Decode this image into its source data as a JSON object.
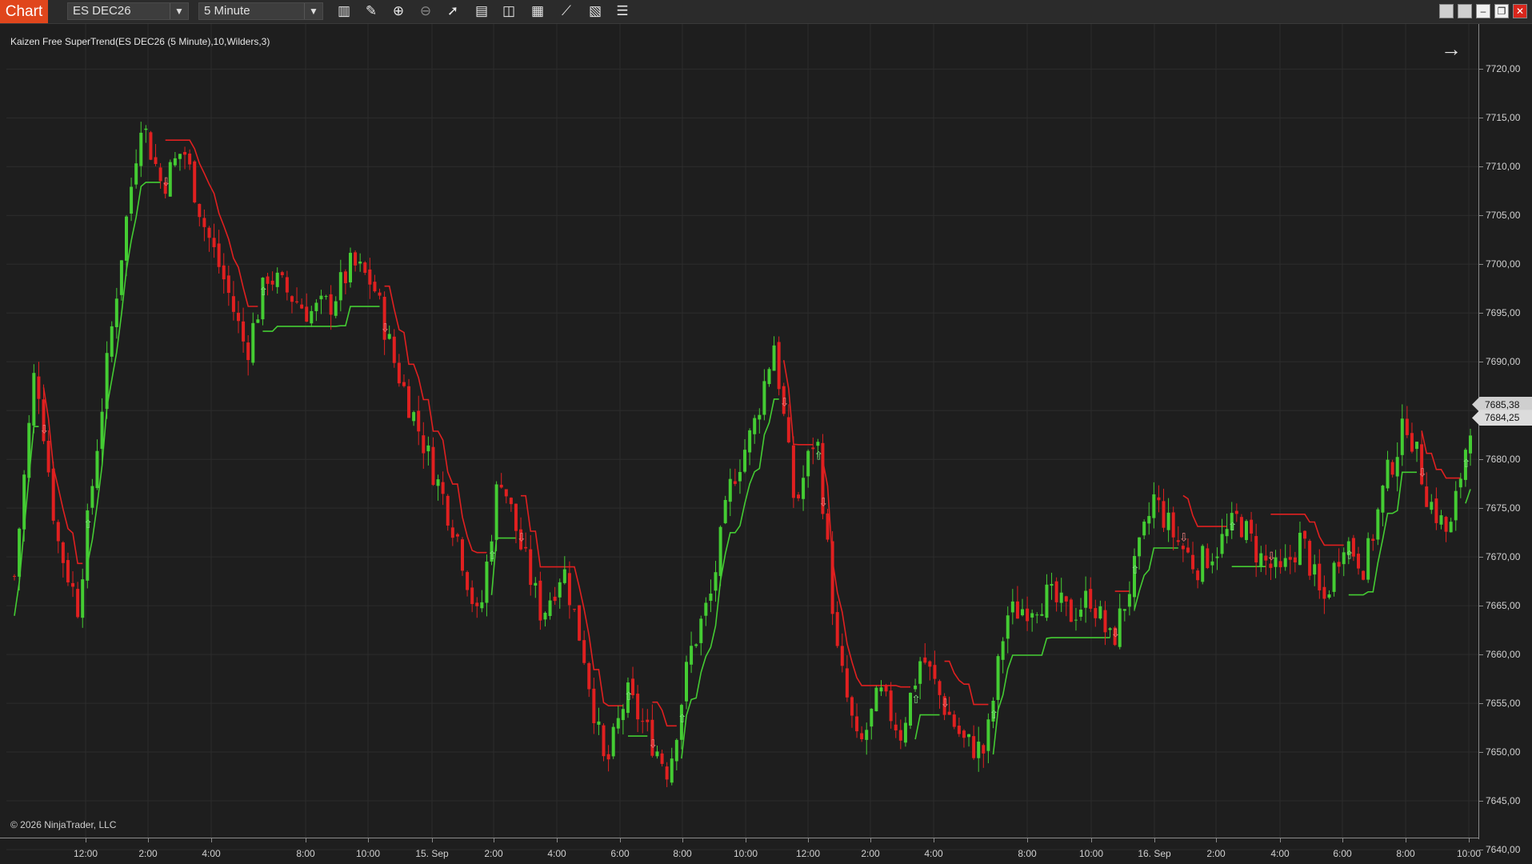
{
  "toolbar": {
    "tab_label": "Chart",
    "instrument": "ES DEC26",
    "interval": "5 Minute",
    "icons": [
      "bar-type-icon",
      "pencil-draw-icon",
      "zoom-in-icon",
      "zoom-out-icon",
      "pointer-icon",
      "data-box-icon",
      "properties-icon",
      "strategies-icon",
      "drawing-tools-icon",
      "chart-trader-icon",
      "indicators-icon"
    ]
  },
  "window_buttons": [
    "tile-icon",
    "float-icon",
    "minimize-icon",
    "maximize-icon",
    "close-icon"
  ],
  "indicator_label": "Kaizen Free SuperTrend(ES DEC26 (5 Minute),10,Wilders,3)",
  "copyright": "© 2026 NinjaTrader, LLC",
  "colors": {
    "background": "#1e1e1e",
    "up_candle": "#44cc33",
    "down_candle": "#e02020",
    "supertrend_up": "#44cc33",
    "supertrend_down": "#e02020",
    "tab_accent": "#e0461c"
  },
  "price_axis": {
    "ticks": [
      "7720,00",
      "7715,00",
      "7710,00",
      "7705,00",
      "7700,00",
      "7695,00",
      "7690,00",
      "7685,00",
      "7680,00",
      "7675,00",
      "7670,00",
      "7665,00",
      "7660,00",
      "7655,00",
      "7650,00",
      "7645,00",
      "7640,00"
    ],
    "tick_values": [
      7720,
      7715,
      7710,
      7705,
      7700,
      7695,
      7690,
      7685,
      7680,
      7675,
      7670,
      7665,
      7660,
      7655,
      7650,
      7645,
      7640
    ],
    "last_price_tag": "7684,25",
    "last_price": 7684.25,
    "supertrend_tag": "7685,38",
    "supertrend_value": 7685.38
  },
  "time_axis": {
    "ticks": [
      "12:00",
      "2:00",
      "4:00",
      "8:00",
      "10:00",
      "15. Sep",
      "2:00",
      "4:00",
      "6:00",
      "8:00",
      "10:00",
      "12:00",
      "2:00",
      "4:00",
      "8:00",
      "10:00",
      "16. Sep",
      "2:00",
      "4:00",
      "6:00",
      "8:00",
      "10:00"
    ]
  },
  "chart_data": {
    "type": "candlestick",
    "title": "Kaizen Free SuperTrend(ES DEC26 (5 Minute),10,Wilders,3)",
    "instrument": "ES DEC26",
    "interval": "5 Minute",
    "ylim": [
      7640,
      7722
    ],
    "last_price": 7684.25,
    "price_path": [
      7668,
      7690,
      7672,
      7665,
      7683,
      7700,
      7715,
      7708,
      7712,
      7704,
      7698,
      7691,
      7699,
      7697,
      7695,
      7696,
      7700,
      7698,
      7690,
      7684,
      7678,
      7672,
      7663,
      7679,
      7671,
      7664,
      7669,
      7660,
      7648,
      7656,
      7652,
      7648,
      7660,
      7666,
      7678,
      7683,
      7692,
      7675,
      7683,
      7660,
      7650,
      7656,
      7652,
      7660,
      7655,
      7651,
      7650,
      7664,
      7665,
      7666,
      7664,
      7666,
      7661,
      7668,
      7676,
      7672,
      7669,
      7671,
      7674,
      7670,
      7668,
      7672,
      7665,
      7672,
      7669,
      7678,
      7684,
      7676,
      7672,
      7684
    ],
    "price_path_note": "approximate close values sampled evenly across the visible session",
    "grid": true
  }
}
